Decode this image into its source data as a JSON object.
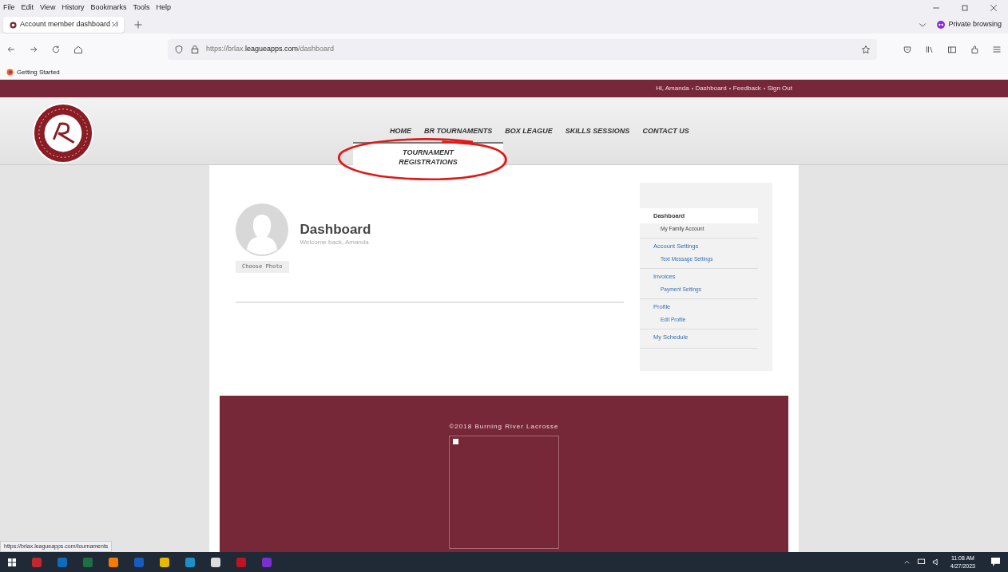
{
  "browser": {
    "menu": [
      "File",
      "Edit",
      "View",
      "History",
      "Bookmarks",
      "Tools",
      "Help"
    ],
    "tabs": [
      {
        "title": "Account member dashboard : I",
        "selected": true
      }
    ],
    "private_label": "Private browsing",
    "url": {
      "prefix": "https://brlax.",
      "domain": "leagueapps.com",
      "path": "/dashboard"
    },
    "bookmarks": [
      "Getting Started"
    ]
  },
  "site": {
    "top_links": [
      "Hi, Amanda",
      "Dashboard",
      "Feedback",
      "Sign Out"
    ],
    "nav": [
      "HOME",
      "BR TOURNAMENTS",
      "BOX LEAGUE",
      "SKILLS SESSIONS",
      "CONTACT US"
    ],
    "dropdown": [
      "TOURNAMENT REGISTRATIONS"
    ],
    "profile": {
      "button": "Choose Photo",
      "title": "Dashboard",
      "subtitle": "Welcome back, Amanda"
    },
    "sidebar": [
      {
        "label": "Dashboard",
        "selected": true,
        "children": [
          {
            "label": "My Family Account",
            "selected": false
          }
        ]
      },
      {
        "label": "Account Settings",
        "selected": false,
        "children": [
          {
            "label": "Text Message Settings",
            "selected": false
          }
        ]
      },
      {
        "label": "Invoices",
        "selected": false,
        "children": [
          {
            "label": "Payment Settings",
            "selected": false
          }
        ]
      },
      {
        "label": "Profile",
        "selected": false,
        "children": [
          {
            "label": "Edit Profile",
            "selected": false
          }
        ]
      },
      {
        "label": "My Schedule",
        "selected": false
      }
    ],
    "footer": "©2018 Burning River Lacrosse"
  },
  "status_url": "https://brlax.leagueapps.com/tournaments",
  "taskbar": {
    "time": "11:08 AM",
    "date": "4/27/2023"
  }
}
